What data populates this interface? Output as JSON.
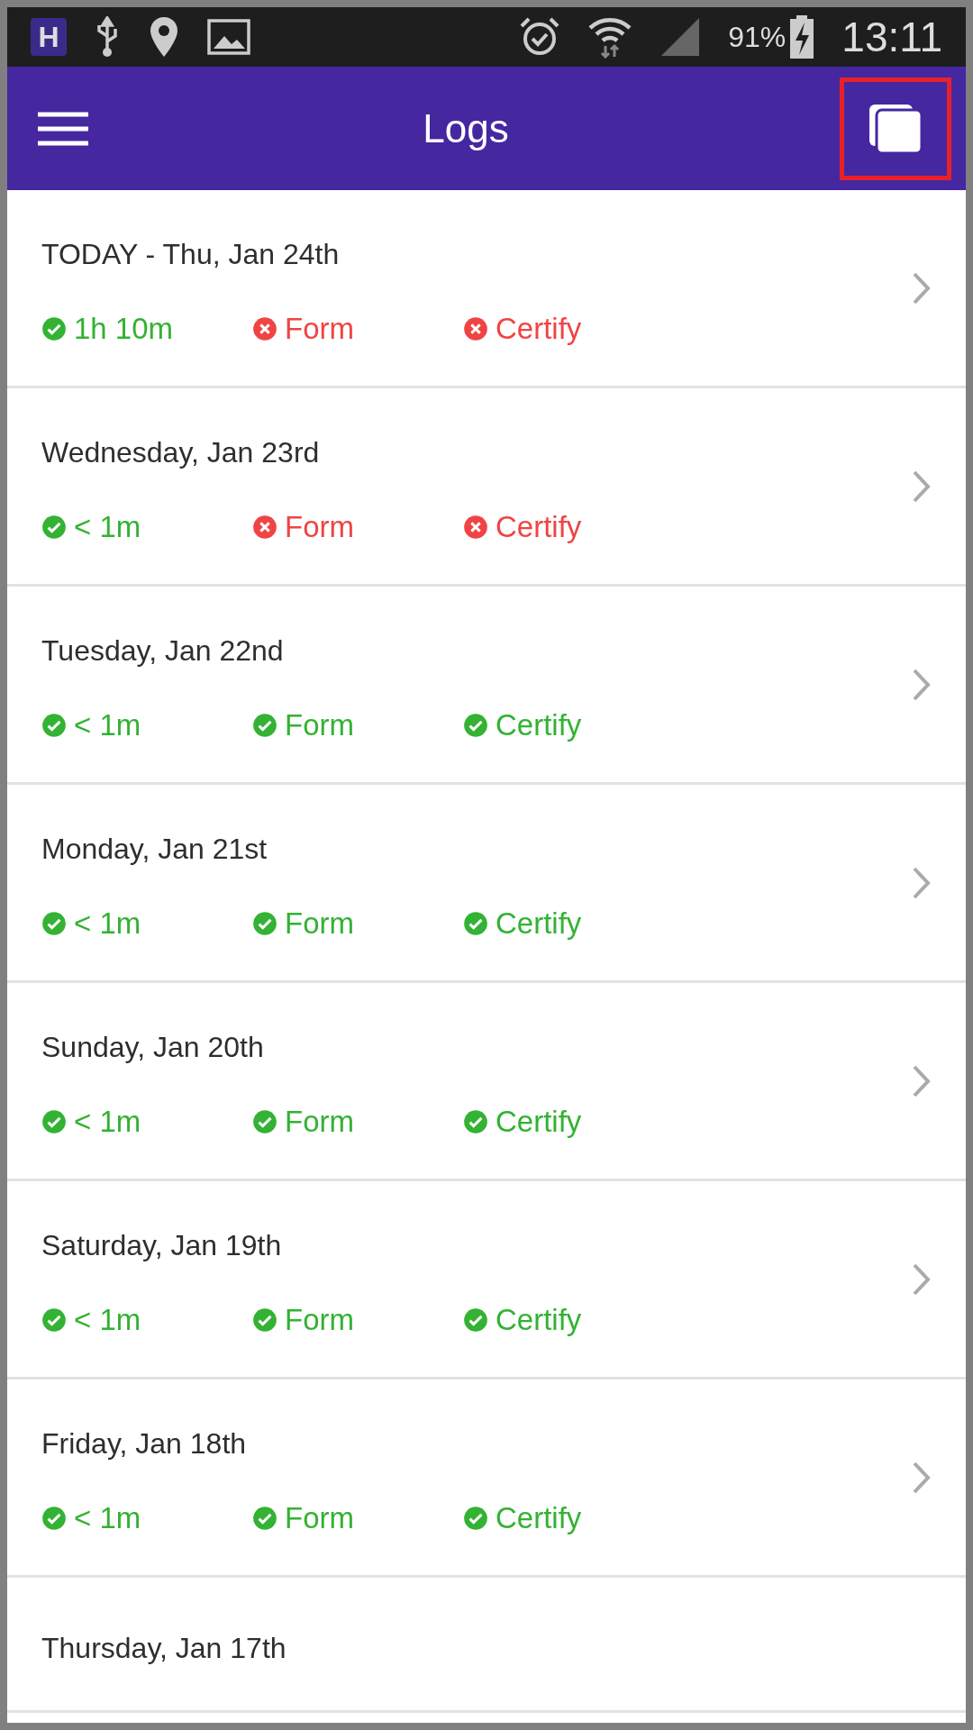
{
  "status_bar": {
    "app_badge": "H",
    "battery": "91%",
    "time": "13:11"
  },
  "app_bar": {
    "title": "Logs",
    "action_highlighted": true
  },
  "logs": [
    {
      "date": "TODAY - Thu, Jan 24th",
      "checks": [
        {
          "label": "1h 10m",
          "ok": true
        },
        {
          "label": "Form",
          "ok": false
        },
        {
          "label": "Certify",
          "ok": false
        }
      ]
    },
    {
      "date": "Wednesday, Jan 23rd",
      "checks": [
        {
          "label": "< 1m",
          "ok": true
        },
        {
          "label": "Form",
          "ok": false
        },
        {
          "label": "Certify",
          "ok": false
        }
      ]
    },
    {
      "date": "Tuesday, Jan 22nd",
      "checks": [
        {
          "label": "< 1m",
          "ok": true
        },
        {
          "label": "Form",
          "ok": true
        },
        {
          "label": "Certify",
          "ok": true
        }
      ]
    },
    {
      "date": "Monday, Jan 21st",
      "checks": [
        {
          "label": "< 1m",
          "ok": true
        },
        {
          "label": "Form",
          "ok": true
        },
        {
          "label": "Certify",
          "ok": true
        }
      ]
    },
    {
      "date": "Sunday, Jan 20th",
      "checks": [
        {
          "label": "< 1m",
          "ok": true
        },
        {
          "label": "Form",
          "ok": true
        },
        {
          "label": "Certify",
          "ok": true
        }
      ]
    },
    {
      "date": "Saturday, Jan 19th",
      "checks": [
        {
          "label": "< 1m",
          "ok": true
        },
        {
          "label": "Form",
          "ok": true
        },
        {
          "label": "Certify",
          "ok": true
        }
      ]
    },
    {
      "date": "Friday, Jan 18th",
      "checks": [
        {
          "label": "< 1m",
          "ok": true
        },
        {
          "label": "Form",
          "ok": true
        },
        {
          "label": "Certify",
          "ok": true
        }
      ]
    },
    {
      "date": "Thursday, Jan 17th"
    }
  ]
}
